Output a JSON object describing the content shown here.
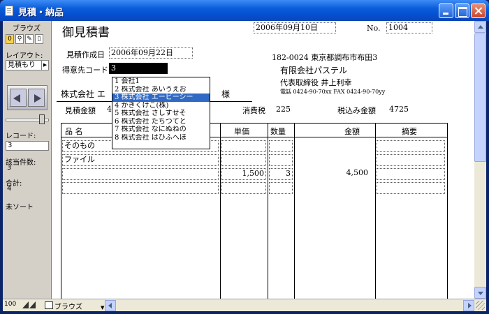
{
  "window": {
    "title": "見積・納品"
  },
  "status": {
    "mode_label": "ブラウズ",
    "tools": [
      "0",
      "⚲",
      "✎",
      "▯"
    ],
    "layout_label": "レイアウト:",
    "layout_value": "見積もり",
    "record_label": "レコード:",
    "record_value": "3",
    "found_label": "該当件数:",
    "found_value": "3",
    "total_label": "合計:",
    "total_value": "4",
    "sort_label": "未ソート"
  },
  "document": {
    "title": "御見積書",
    "date_value": "2006年09月10日",
    "no_label": "No.",
    "no_value": "1004",
    "created_label": "見積作成日",
    "created_value": "2006年09月22日",
    "client_code_label": "得意先コード",
    "client_code_value": "3",
    "client_name_prefix": "株式会社 エ",
    "honorific": "様",
    "amount_label": "見積金額",
    "amount_value": "4",
    "tax_label": "消費税",
    "tax_value": "225",
    "total_label": "税込み金額",
    "total_value": "4725",
    "address": "182-0024  東京都調布市布田3",
    "company": "有限会社パステル",
    "rep": "代表取締役  井上利幸",
    "phone": "電話 0424-90-70xx FAX 0424-90-70yy"
  },
  "dropdown": {
    "items": [
      "1 会社1",
      "2 株式会社 あいうえお",
      "3 株式会社 エービーシー",
      "4 かきくけこ(株)",
      "5 株式会社 さしすせそ",
      "6 株式会社 たちつてと",
      "7 株式会社 なにぬねの",
      "8 株式会社 はひふへほ"
    ],
    "selected_index": 2
  },
  "table": {
    "headers": {
      "name": "品  名",
      "unit_price": "単価",
      "quantity": "数量",
      "amount": "金額",
      "remarks": "摘要"
    },
    "rows": [
      {
        "name": "そのもの",
        "unit_price": "",
        "quantity": "",
        "amount": "",
        "remarks": ""
      },
      {
        "name": "ファイル",
        "unit_price": "",
        "quantity": "",
        "amount": "",
        "remarks": ""
      },
      {
        "name": "",
        "unit_price": "1,500",
        "quantity": "3",
        "amount": "4,500",
        "remarks": ""
      },
      {
        "name": "",
        "unit_price": "",
        "quantity": "",
        "amount": "",
        "remarks": ""
      }
    ]
  },
  "bottombar": {
    "zoom": "100",
    "mode": "ブラウズ"
  }
}
